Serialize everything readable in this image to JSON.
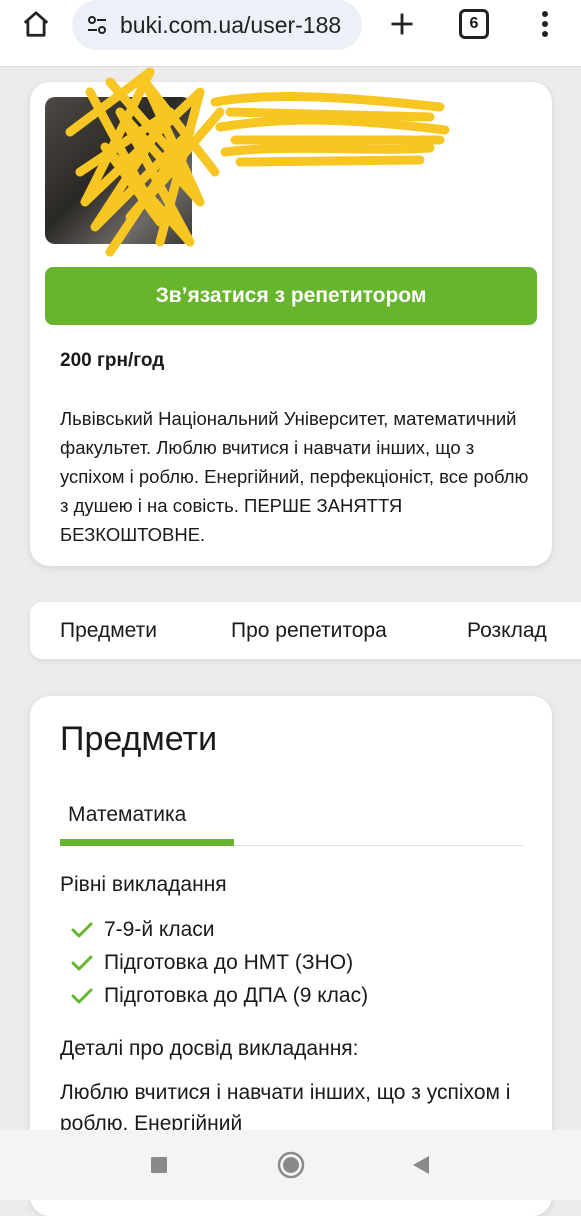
{
  "browser": {
    "url": "buki.com.ua/user-188",
    "tab_count": "6",
    "icons": [
      "home-icon",
      "site-settings-icon",
      "plus-icon",
      "tabs-icon",
      "more-vert-icon"
    ]
  },
  "profile": {
    "contact_button": "Зв’язатися з репетитором",
    "price": "200 грн/год",
    "bio": "Львівський Національний Університет, математичний факультет. Люблю вчитися і навчати інших, що з успіхом і роблю. Енергійний, перфекціоніст, все роблю з душею і на совість. ПЕРШЕ ЗАНЯТТЯ БЕЗКОШТОВНЕ."
  },
  "tabs": [
    {
      "label": "Предмети"
    },
    {
      "label": "Про репетитора"
    },
    {
      "label": "Розклад"
    }
  ],
  "subjects": {
    "title": "Предмети",
    "active_subject": "Математика",
    "levels_heading": "Рівні викладання",
    "levels": [
      "7-9-й класи",
      "Підготовка до НМТ (ЗНО)",
      "Підготовка до ДПА (9 клас)"
    ],
    "details_heading": "Деталі про досвід викладання:",
    "details_text": "Люблю вчитися і навчати інших, що з успіхом і роблю. Енергійний"
  },
  "colors": {
    "accent_green": "#66b52d",
    "redaction_yellow": "#f7c623",
    "page_bg": "#ececec"
  },
  "nav_bar": {
    "icons": [
      "recents-icon",
      "home-circle-icon",
      "back-icon"
    ]
  }
}
